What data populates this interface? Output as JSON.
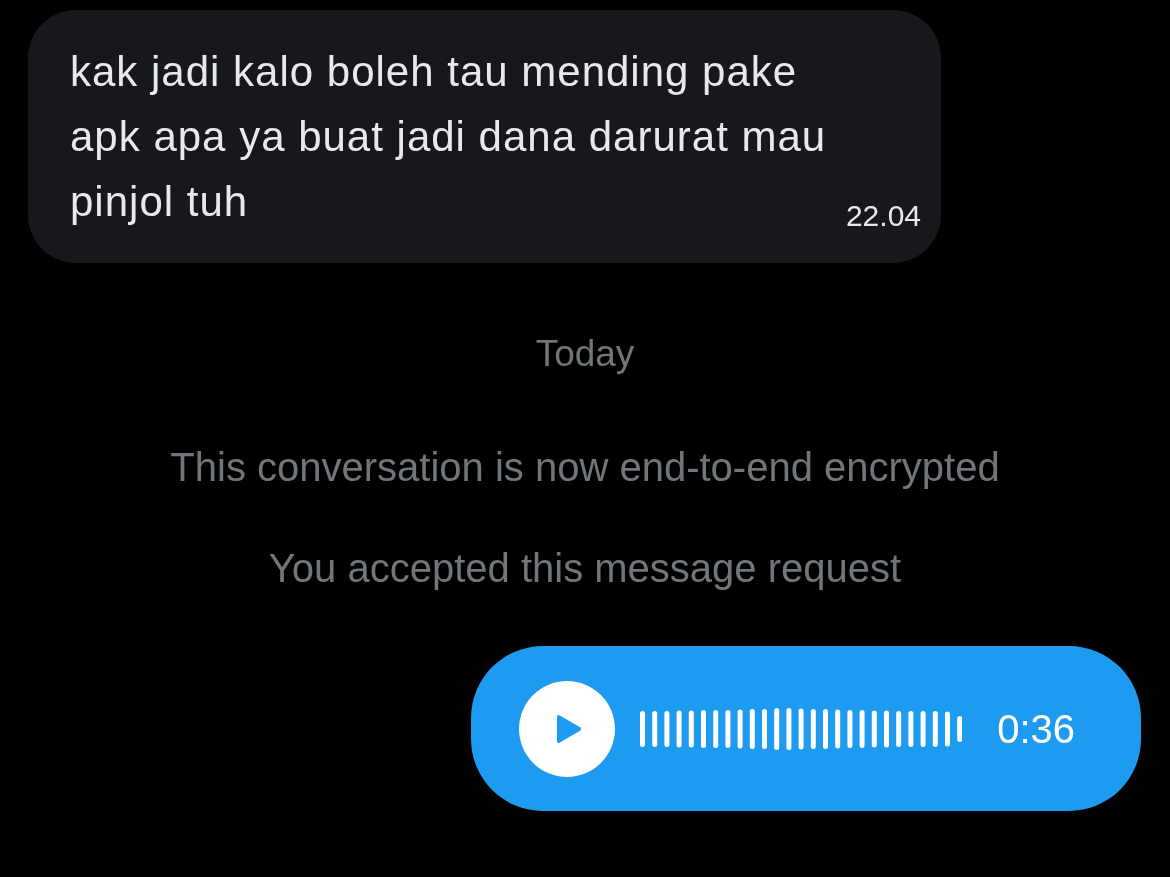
{
  "conversation": [
    {
      "kind": "text",
      "text": "kak jadi kalo boleh tau mending pake apk apa ya buat jadi dana darurat mau pinjol tuh",
      "time": "22.04"
    },
    {
      "kind": "date",
      "text": "Today"
    },
    {
      "kind": "notice",
      "text": "This conversation is now end-to-end encrypted"
    },
    {
      "kind": "notice",
      "text": "You accepted this message request"
    },
    {
      "kind": "voice",
      "duration": "0:36"
    }
  ]
}
